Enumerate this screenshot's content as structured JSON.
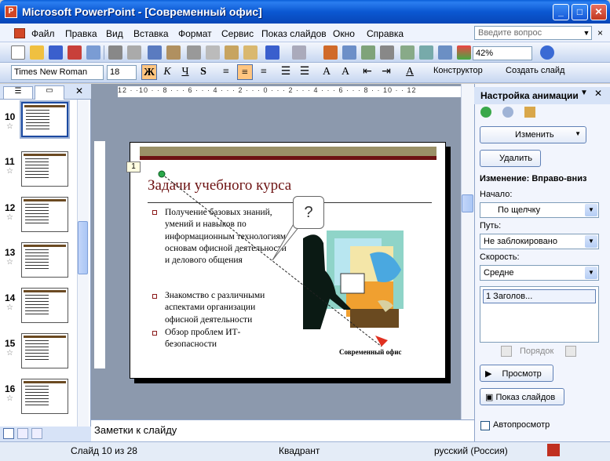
{
  "window": {
    "title": "Microsoft PowerPoint - [Современный офис]",
    "minimize": "_",
    "maximize": "□",
    "close": "✕"
  },
  "menu": {
    "items": [
      "Файл",
      "Правка",
      "Вид",
      "Вставка",
      "Формат",
      "Сервис",
      "Показ слайдов",
      "Окно",
      "Справка"
    ],
    "help_placeholder": "Введите вопрос",
    "close": "×"
  },
  "toolbar": {
    "zoom": "42%"
  },
  "format_toolbar": {
    "font": "Times New Roman",
    "size": "18",
    "bold": "Ж",
    "italic": "К",
    "underline": "Ч",
    "shadow": "S",
    "designer": "Конструктор",
    "new_slide": "Создать слайд"
  },
  "thumbnails": [
    {
      "num": "10"
    },
    {
      "num": "11"
    },
    {
      "num": "12"
    },
    {
      "num": "13"
    },
    {
      "num": "14"
    },
    {
      "num": "15"
    },
    {
      "num": "16"
    }
  ],
  "ruler": {
    "horizontal": "12 · ·10 · · 8 · · · 6 · · · 4 · · · 2 · · · 0 · · · 2 · · · 4 · · · 6 · · · 8 · · 10 · · 12"
  },
  "slide": {
    "anim_badge": "1",
    "title": "Задачи учебного курса",
    "bullets": [
      "Получение базовых знаний, умений и навыков по информационным технологиям, основам офисной деятельности и делового общения",
      "Знакомство с различными аспектами организации офисной деятельности",
      "Обзор проблем ИТ-безопасности"
    ],
    "callout": "?",
    "footer": "Современный офис"
  },
  "notes": {
    "label": "Заметки к слайду"
  },
  "task_pane": {
    "title": "Настройка анимации",
    "change_button": "Изменить",
    "delete_button": "Удалить",
    "change_heading": "Изменение: Вправо-вниз",
    "start_label": "Начало:",
    "start_value": "По щелчку",
    "path_label": "Путь:",
    "path_value": "Не заблокировано",
    "speed_label": "Скорость:",
    "speed_value": "Средне",
    "list_item": "1     Заголов...",
    "order_label": "Порядок",
    "preview_button": "Просмотр",
    "slideshow_button": "Показ слайдов",
    "autopreview": "Автопросмотр"
  },
  "status": {
    "slide": "Слайд 10 из 28",
    "design": "Квадрант",
    "language": "русский (Россия)"
  }
}
